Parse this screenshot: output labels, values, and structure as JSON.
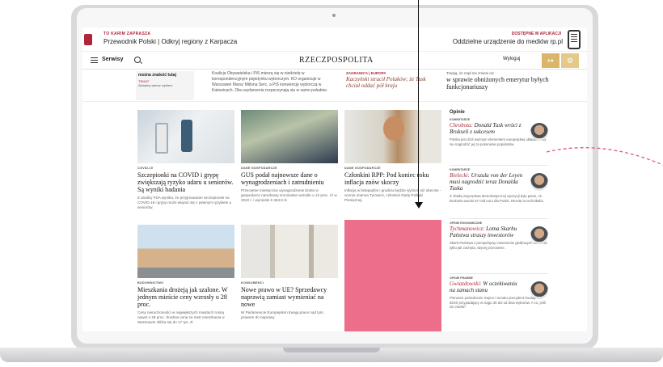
{
  "ad_left": {
    "small": "TO KARIM ZAPRASZA",
    "text": "Przewodnik Polski | Odkryj regiony z Karpacza"
  },
  "ad_right": {
    "small": "DOSTĘPNE W APLIKACJI",
    "text": "Oddzielne urządzenie do mediów rp.pl"
  },
  "nav": {
    "menu_label": "Serwisy",
    "logo": "RZECZPOSPOLITA",
    "logout_label": "Wyloguj",
    "exit_icon": "↦",
    "gear_icon": "⚙"
  },
  "strip": {
    "box_question": "można znaleźć tutaj",
    "box_tag": "TEMAT",
    "box_sub": "Aktualny wiersz wybierz",
    "mid_text": "Koalicja Obywatelska i PiS mierzą się w niedzielę w korespondencyjnym pojedynku wyborczym. KO organizuje w Warszawie Marsz Miliona Serc, a PiS konwencję wyborczą w Katowicach. Obu wydarzenia rozpoczynają się w samo południe.",
    "kicker": "ZAGRANICA | EUROPA",
    "italic_title": "Kaczyński stracił Polaków; że Tusk chciał oddać pół kraju",
    "right_sub": "Trwają, że rząd nie zmieni nic",
    "right_title": "w sprawie obniżonych emerytur byłych funkcjonariuszy"
  },
  "articles": [
    {
      "kicker": "COVID-19",
      "title": "Szczepionki na COVID i grypę zwiększają ryzyko udaru u seniorów. Są wyniki badania",
      "lead": "Z analizy FDA wynika, że przyjmowanie szczepionek na COVID-19 i grypy może wiązać się z pewnym ryzykiem u seniorów."
    },
    {
      "kicker": "DANE GOSPODARCZE",
      "title": "GUS podał najnowsze dane o wynagrodzeniach i zatrudnieniu",
      "lead": "Przeciętne miesięczne wynagrodzenie brutto w gospodarce narodowej nominalnie wzrosło o 12 proc. r/r w 2022 r. i wyniosło 6 363,9 zł."
    },
    {
      "kicker": "DANE GOSPODARCZE",
      "title": "Członkini RPP: Pod koniec roku inflacja znów skoczy",
      "lead": "Inflacja w listopadzie i grudniu będzie wyższa niż obecnie - ocenia Joanna Tyrowicz, członkini Rady Polityki Pieniężnej."
    },
    {
      "kicker": "BUDOWNICTWO",
      "title": "Mieszkania drożeją jak szalone. W jednym mieście ceny wzrosły o 28 proc.",
      "lead": "Ceny nieruchomości w największych miastach rosną nawet o 28 proc. Średnia cena za metr mieszkania w Warszawie zbliża się do 17 tys. zł."
    },
    {
      "kicker": "KONSUMENCI",
      "title": "Nowe prawo w UE? Sprzedawcy naprawią zamiast wymieniać na nowe",
      "lead": "W Parlamencie Europejskim trwają prace nad tym, prawem do naprawy."
    }
  ],
  "opinions": {
    "heading": "Opinie",
    "items": [
      {
        "kicker": "KOMENTARZE",
        "author": "Chrobota:",
        "title": " Donald Tusk wróci z Brukseli z sukcesem",
        "lead": "Polska jest dziś ważnym elementem europejskiej układanki, by nie nagrodzić jej za pokonanie populistów."
      },
      {
        "kicker": "KOMENTARZE",
        "author": "Bielecki:",
        "title": " Urszula von der Leyen musi nagrodzić teraz Donalda Tuska",
        "lead": "Z chwilą zwycięstwa demokratycznej opozycji były panie, że Bruksela uwolni 57 mld euro dla Polski. Reszta to technikalia."
      },
      {
        "kicker": "OPINIE EKONOMICZNE",
        "author": "Tychmanowicz:",
        "title": " Lotna Skarbu Państwa straszy inwestorów",
        "lead": "Skarb Państwa z perspektywy inwestorów giełdowych ocala nie tylko jak zachęta, więcej przeciwnie."
      },
      {
        "kicker": "OPINIE PRAWNE",
        "author": "Gwiazdowski:",
        "title": " W oczekiwaniu na zamach stanu",
        "lead": "Pierwsze posiedzenie Sejmu i Senatu prezydent zwołuje na dzień przypadający w ciągu 30 dni od dnia wyborów. A co, jeśli nie zwoła?"
      }
    ]
  },
  "colors": {
    "accent": "#b0253a",
    "gold": "#d9b66a",
    "pink_ad": "#ec6e8a"
  }
}
